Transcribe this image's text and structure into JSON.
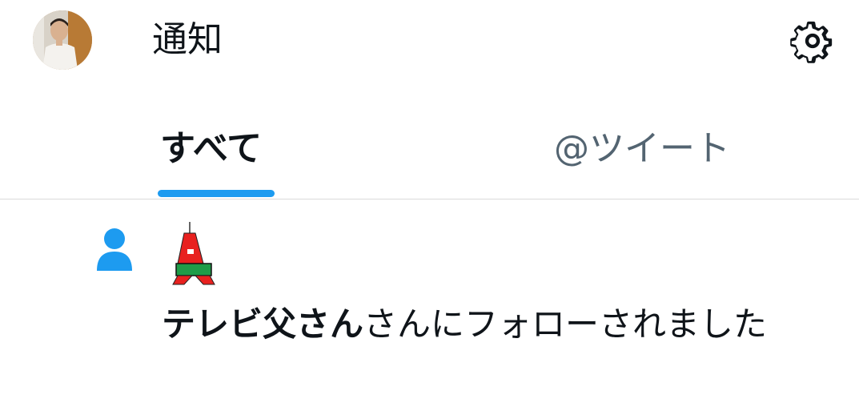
{
  "header": {
    "title": "通知",
    "avatar_icon": "user-photo-avatar",
    "settings_icon": "gear-icon"
  },
  "tabs": [
    {
      "label": "すべて",
      "active": true
    },
    {
      "label": "@ツイート",
      "active": false
    }
  ],
  "notifications": [
    {
      "type_icon": "person-icon",
      "follower_avatar": "red-tower-avatar",
      "user_name": "テレビ父さん",
      "message": "さんにフォローされました"
    }
  ],
  "colors": {
    "accent": "#1d9bf0",
    "text_primary": "#0f1419",
    "text_secondary": "#536471",
    "divider": "#dadada"
  }
}
